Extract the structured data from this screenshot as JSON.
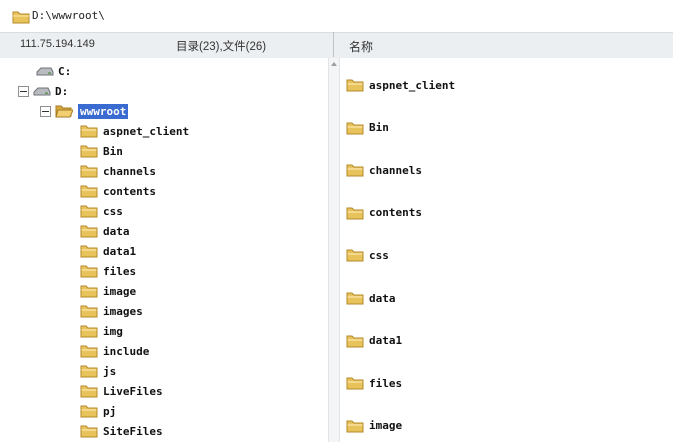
{
  "titlebar": {
    "path": "D:\\wwwroot\\"
  },
  "infobar": {
    "ip": "111.75.194.149",
    "counts": "目录(23),文件(26)",
    "name_column": "名称"
  },
  "tree": {
    "drive_c": "C:",
    "drive_d": "D:",
    "root_folder": "wwwroot",
    "children": [
      "aspnet_client",
      "Bin",
      "channels",
      "contents",
      "css",
      "data",
      "data1",
      "files",
      "image",
      "images",
      "img",
      "include",
      "js",
      "LiveFiles",
      "pj",
      "SiteFiles"
    ]
  },
  "list": {
    "items": [
      "aspnet_client",
      "Bin",
      "channels",
      "contents",
      "css",
      "data",
      "data1",
      "files",
      "image"
    ]
  },
  "colors": {
    "folder": "#e8c25a",
    "selection": "#3a6bd1",
    "infobar": "#eceff1"
  }
}
